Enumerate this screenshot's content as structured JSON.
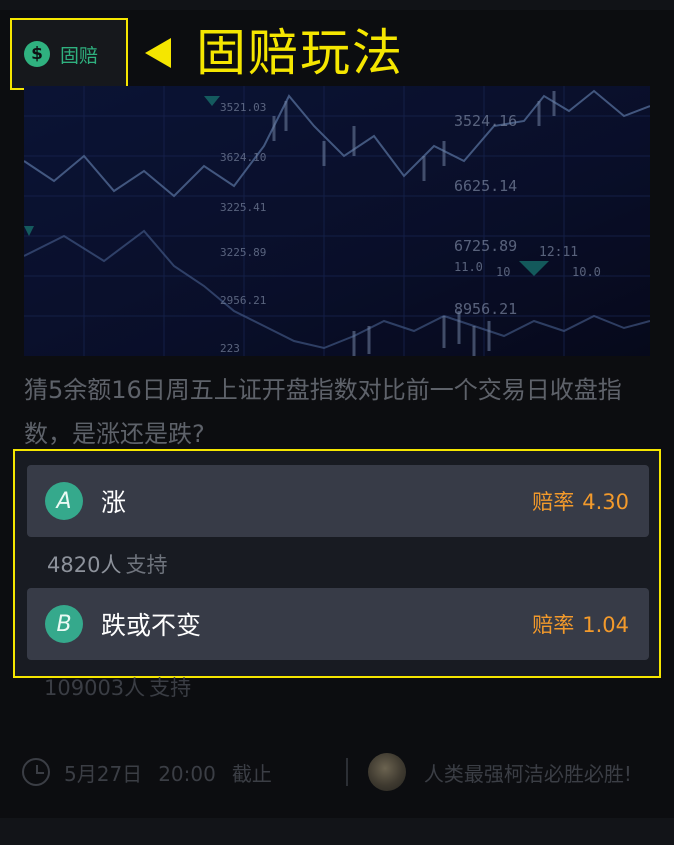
{
  "header": {
    "badge_icon": "dollar-icon",
    "badge_label": "固赔",
    "annotation_title": "固赔玩法",
    "pointer_icon": "left-triangle-icon"
  },
  "banner": {
    "labels": [
      "3521.03",
      "3524.16",
      "6625.14",
      "3624.10",
      "3225.41",
      "3225.89",
      "6725.89",
      "2956.21",
      "8956.21",
      "12:11",
      "11.0",
      "10",
      "10.0",
      "223"
    ]
  },
  "question": "猜5余额16日周五上证开盘指数对比前一个交易日收盘指数，是涨还是跌?",
  "options": [
    {
      "letter": "A",
      "label": "涨",
      "odds_label": "赔率",
      "odds_value": "4.30",
      "supporters": "4820人",
      "supporters_suffix": "支持"
    },
    {
      "letter": "B",
      "label": "跌或不变",
      "odds_label": "赔率",
      "odds_value": "1.04",
      "supporters": "109003人",
      "supporters_suffix": "支持"
    }
  ],
  "footer": {
    "date": "5月27日",
    "time": "20:00",
    "deadline_suffix": "截止",
    "user_name": "人类最强柯洁必胜必胜!"
  },
  "colors": {
    "accent_green": "#2fb17f",
    "highlight_yellow": "#f5e600",
    "odds_orange": "#f39a2b",
    "option_bg": "#373b47"
  }
}
